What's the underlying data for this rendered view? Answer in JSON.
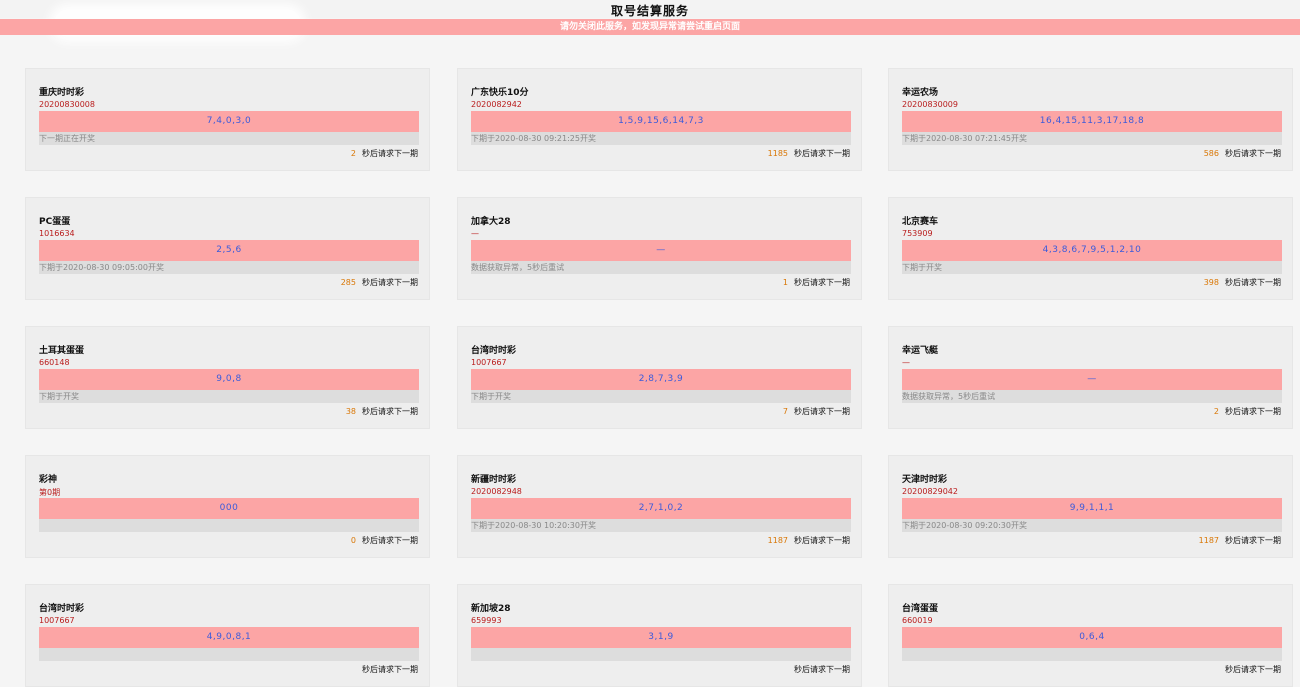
{
  "header": {
    "title": "取号结算服务",
    "notice": "请勿关闭此服务，如发现异常请尝试重启页面"
  },
  "countdown_suffix": "秒后请求下一期",
  "cards": [
    {
      "name": "重庆时时彩",
      "issue": "20200830008",
      "result": "7,4,0,3,0",
      "next": "下一期正在开奖",
      "countdown": "2"
    },
    {
      "name": "广东快乐10分",
      "issue": "2020082942",
      "result": "1,5,9,15,6,14,7,3",
      "next": "下期于2020-08-30 09:21:25开奖",
      "countdown": "1185"
    },
    {
      "name": "幸运农场",
      "issue": "20200830009",
      "result": "16,4,15,11,3,17,18,8",
      "next": "下期于2020-08-30 07:21:45开奖",
      "countdown": "586"
    },
    {
      "name": "PC蛋蛋",
      "issue": "1016634",
      "result": "2,5,6",
      "next": "下期于2020-08-30 09:05:00开奖",
      "countdown": "285"
    },
    {
      "name": "加拿大28",
      "issue": "—",
      "result": "—",
      "next": "数据获取异常，5秒后重试",
      "countdown": "1"
    },
    {
      "name": "北京赛车",
      "issue": "753909",
      "result": "4,3,8,6,7,9,5,1,2,10",
      "next": "下期于开奖",
      "countdown": "398"
    },
    {
      "name": "土耳其蛋蛋",
      "issue": "660148",
      "result": "9,0,8",
      "next": "下期于开奖",
      "countdown": "38"
    },
    {
      "name": "台湾时时彩",
      "issue": "1007667",
      "result": "2,8,7,3,9",
      "next": "下期于开奖",
      "countdown": "7"
    },
    {
      "name": "幸运飞艇",
      "issue": "—",
      "result": "—",
      "next": "数据获取异常，5秒后重试",
      "countdown": "2"
    },
    {
      "name": "彩神",
      "issue": "第0期",
      "result": "000",
      "next": "",
      "countdown": "0"
    },
    {
      "name": "新疆时时彩",
      "issue": "2020082948",
      "result": "2,7,1,0,2",
      "next": "下期于2020-08-30 10:20:30开奖",
      "countdown": "1187"
    },
    {
      "name": "天津时时彩",
      "issue": "20200829042",
      "result": "9,9,1,1,1",
      "next": "下期于2020-08-30 09:20:30开奖",
      "countdown": "1187"
    },
    {
      "name": "台湾时时彩",
      "issue": "1007667",
      "result": "4,9,0,8,1",
      "next": "",
      "countdown": ""
    },
    {
      "name": "新加坡28",
      "issue": "659993",
      "result": "3,1,9",
      "next": "",
      "countdown": ""
    },
    {
      "name": "台湾蛋蛋",
      "issue": "660019",
      "result": "0,6,4",
      "next": "",
      "countdown": ""
    }
  ]
}
